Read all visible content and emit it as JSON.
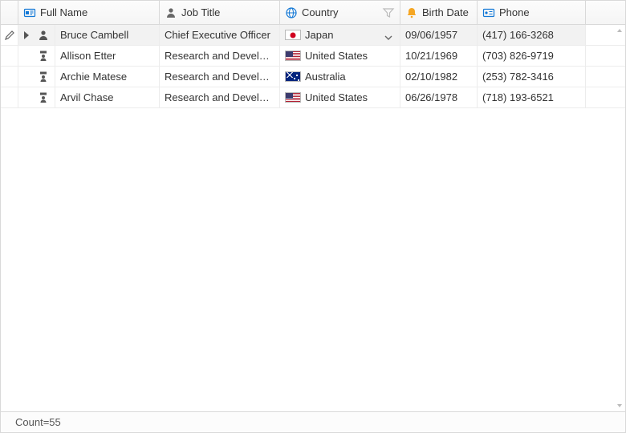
{
  "columns": {
    "name": "Full Name",
    "job": "Job Title",
    "country": "Country",
    "birth": "Birth Date",
    "phone": "Phone"
  },
  "rows": [
    {
      "name": "Bruce Cambell",
      "job": "Chief Executive Officer",
      "country": "Japan",
      "flag": "jp",
      "birth": "09/06/1957",
      "phone": "(417) 166-3268",
      "level": 0,
      "expandable": true,
      "focused": true,
      "editing": true,
      "active_country_editor": true
    },
    {
      "name": "Allison Etter",
      "job": "Research and Develop...",
      "country": "United States",
      "flag": "us",
      "birth": "10/21/1969",
      "phone": "(703) 826-9719",
      "level": 1
    },
    {
      "name": "Archie Matese",
      "job": "Research and Develop...",
      "country": "Australia",
      "flag": "au",
      "birth": "02/10/1982",
      "phone": "(253) 782-3416",
      "level": 1
    },
    {
      "name": "Arvil Chase",
      "job": "Research and Develop...",
      "country": "United States",
      "flag": "us",
      "birth": "06/26/1978",
      "phone": "(718) 193-6521",
      "level": 1
    }
  ],
  "footer": {
    "summary": "Count=55"
  }
}
